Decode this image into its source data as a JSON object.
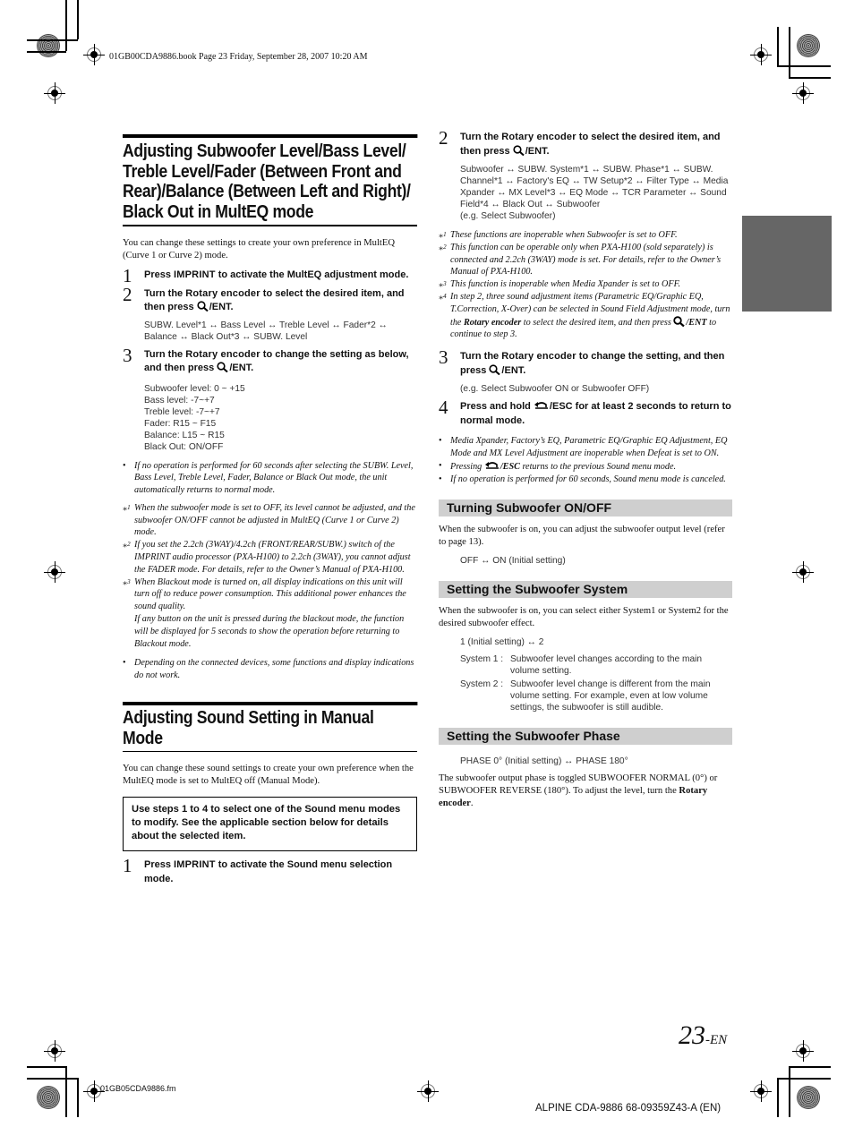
{
  "print_meta": {
    "header": "01GB00CDA9886.book  Page 23  Friday, September 28, 2007  10:20 AM",
    "footer_file": "01GB05CDA9886.fm",
    "footer_model": "ALPINE CDA-9886 68-09359Z43-A (EN)"
  },
  "page_number": {
    "number": "23",
    "suffix": "-EN"
  },
  "left": {
    "section1": {
      "title": "Adjusting Subwoofer Level/Bass Level/ Treble Level/Fader (Between Front and Rear)/Balance (Between Left and Right)/ Black Out in MultEQ mode",
      "intro": "You can change these settings to create your own preference in MultEQ (Curve 1 or Curve 2) mode.",
      "steps": [
        {
          "num": "1",
          "pre": "Press ",
          "bold": "IMPRINT",
          "post": " to activate the MultEQ adjustment mode."
        },
        {
          "num": "2",
          "pre": "Turn the ",
          "bold": "Rotary encoder",
          "post": " to select the desired item, and then press",
          "key": "/ENT.",
          "sub": "SUBW. Level*1 ↔ Bass Level ↔ Treble Level ↔ Fader*2 ↔ Balance ↔ Black Out*3 ↔ SUBW. Level"
        },
        {
          "num": "3",
          "pre": "Turn the ",
          "bold": "Rotary encoder",
          "post": " to change the setting as below, and then press",
          "key": "/ENT."
        }
      ],
      "ranges": [
        "Subwoofer level: 0 ~ +15",
        "Bass level: -7~+7",
        "Treble level: -7~+7",
        "Fader: R15 ~ F15",
        "Balance: L15 ~ R15",
        "Black Out: ON/OFF"
      ],
      "bullet1": "If no operation is performed for 60 seconds after selecting the SUBW. Level, Bass Level, Treble Level, Fader, Balance or Black Out mode, the unit automatically returns to normal mode.",
      "footnotes": [
        {
          "mark": "*1",
          "text": "When the subwoofer mode is set to OFF, its level cannot be adjusted, and the subwoofer ON/OFF cannot be adjusted in MultEQ (Curve 1 or Curve 2) mode."
        },
        {
          "mark": "*2",
          "text": "If you set the 2.2ch (3WAY)/4.2ch (FRONT/REAR/SUBW.) switch of the IMPRINT audio processor (PXA-H100) to 2.2ch (3WAY), you cannot adjust the FADER mode. For details, refer to the Owner’s Manual of PXA-H100."
        },
        {
          "mark": "*3",
          "text": "When Blackout mode is turned on, all display indications on this unit will turn off to reduce power consumption. This additional power enhances the sound quality.",
          "text2": "If any button on the unit is pressed during the blackout mode, the function will be displayed for 5 seconds to show the operation before returning to Blackout mode."
        }
      ],
      "bullet2": "Depending on the connected devices, some functions and display indications do not work."
    },
    "section2": {
      "title": "Adjusting Sound Setting in Manual Mode",
      "intro": "You can change these sound settings to create your own preference when the MultEQ mode is set to MultEQ off (Manual Mode).",
      "box": "Use steps 1 to 4 to select one of the Sound menu modes to modify. See the applicable section below for details about the selected item.",
      "step1": {
        "num": "1",
        "pre": "Press ",
        "bold": "IMPRINT",
        "post": " to activate the Sound menu selection mode."
      }
    }
  },
  "right": {
    "step2": {
      "num": "2",
      "pre": "Turn the ",
      "bold": "Rotary encoder",
      "post": " to select the desired item, and then press",
      "key": "/ENT.",
      "sub": "Subwoofer ↔ SUBW. System*1 ↔ SUBW. Phase*1 ↔ SUBW. Channel*1 ↔ Factory's EQ ↔ TW Setup*2 ↔ Filter Type ↔ Media Xpander ↔ MX Level*3 ↔ EQ Mode ↔ TCR Parameter ↔ Sound Field*4 ↔ Black Out ↔ Subwoofer",
      "example": "(e.g. Select Subwoofer)"
    },
    "footnotes": [
      {
        "mark": "*1",
        "text": "These functions are inoperable when Subwoofer is set to OFF."
      },
      {
        "mark": "*2",
        "text": "This function can be operable only when PXA-H100 (sold separately) is connected and 2.2ch (3WAY) mode is set. For details, refer to the Owner’s Manual of PXA-H100."
      },
      {
        "mark": "*3",
        "text": "This function is inoperable when Media Xpander is set to OFF."
      },
      {
        "mark": "*4",
        "pre": "In step 2, three sound adjustment items (Parametric EQ/Graphic EQ, T.Correction, X-Over) can be selected in Sound Field Adjustment mode, turn the ",
        "bold": "Rotary encoder",
        "mid": " to select the desired item, and then press ",
        "key": "/ENT",
        "post": " to continue to step 3."
      }
    ],
    "step3": {
      "num": "3",
      "pre": "Turn the ",
      "bold": "Rotary encoder",
      "post": " to change the setting, and then press",
      "key": "/ENT.",
      "sub": "(e.g. Select Subwoofer ON or Subwoofer OFF)"
    },
    "step4": {
      "num": "4",
      "pre": "Press and hold ",
      "key": "/ESC",
      "post": " for at least 2 seconds to return to normal mode."
    },
    "bullets": [
      {
        "text": "Media Xpander, Factory’s EQ, Parametric EQ/Graphic EQ Adjustment, EQ Mode and MX Level Adjustment are inoperable when Defeat is set to ON."
      },
      {
        "pre": "Pressing ",
        "key": "/ESC",
        "post": " returns to the previous Sound menu mode."
      },
      {
        "text": "If no operation is performed for 60 seconds, Sound menu mode is canceled."
      }
    ],
    "sub_on_off": {
      "title": "Turning Subwoofer ON/OFF",
      "body": "When the subwoofer is on, you can adjust the subwoofer output level (refer to page 13).",
      "options": "OFF ↔ ON (Initial setting)"
    },
    "sub_system": {
      "title": "Setting the Subwoofer System",
      "body": "When the subwoofer is on, you can select either System1 or System2 for the desired subwoofer effect.",
      "options": "1 (Initial setting) ↔ 2",
      "systems": [
        {
          "key": "System 1 :",
          "desc": "Subwoofer level changes according to the main volume setting."
        },
        {
          "key": "System 2 :",
          "desc": "Subwoofer level change is different from the main volume setting. For example, even at low volume settings, the subwoofer is still audible."
        }
      ]
    },
    "sub_phase": {
      "title": "Setting the Subwoofer Phase",
      "options": "PHASE 0° (Initial setting) ↔ PHASE 180°",
      "body_pre": "The subwoofer output phase is toggled SUBWOOFER NORMAL (0°) or SUBWOOFER REVERSE (180°). To adjust the level, turn the ",
      "body_bold": "Rotary encoder",
      "body_post": "."
    }
  },
  "icons": {
    "enter": "magnifier-icon",
    "escape": "return-arrow-icon"
  },
  "colors": {
    "subheading_bg": "#cfcfcf",
    "side_tab": "#666666"
  }
}
